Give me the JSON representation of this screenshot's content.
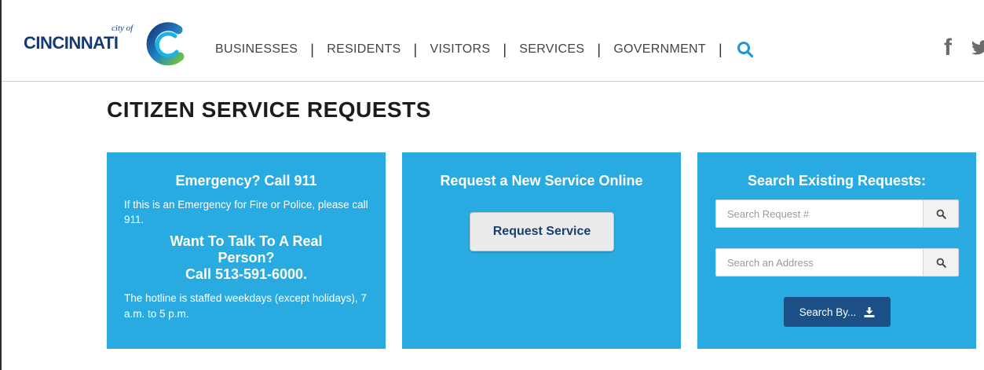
{
  "header": {
    "logo_cityof": "city of",
    "logo_word": "CINCINNATI",
    "nav": [
      {
        "label": "BUSINESSES"
      },
      {
        "label": "RESIDENTS"
      },
      {
        "label": "VISITORS"
      },
      {
        "label": "SERVICES"
      },
      {
        "label": "GOVERNMENT"
      }
    ],
    "nav_separator": "|",
    "search_icon": "search-icon",
    "social": {
      "facebook": "f",
      "twitter_icon": "twitter-icon"
    }
  },
  "page": {
    "title": "CITIZEN SERVICE REQUESTS"
  },
  "emergency": {
    "heading": "Emergency? Call 911",
    "text": "If this is an Emergency for Fire or Police, please call 911.",
    "talk_line1": "Want To Talk To A Real Person?",
    "talk_line2": "Call 513-591-6000.",
    "hotline": "The hotline is staffed weekdays (except holidays), 7 a.m. to 5 p.m."
  },
  "request": {
    "heading": "Request a New Service Online",
    "button": "Request Service"
  },
  "search": {
    "heading": "Search Existing Requests:",
    "request_placeholder": "Search Request #",
    "address_placeholder": "Search an Address",
    "search_by_button": "Search By...",
    "download_icon": "download-icon"
  },
  "colors": {
    "panel": "#29abe2",
    "brand_navy": "#163a78",
    "search_by_button": "#1c4f86",
    "nav_search_icon": "#2196d3"
  }
}
